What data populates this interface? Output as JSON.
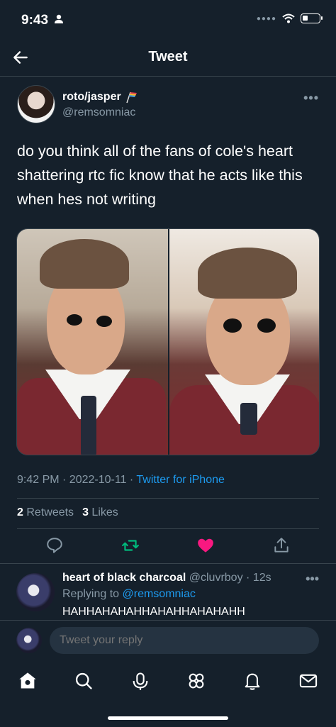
{
  "status_bar": {
    "time": "9:43"
  },
  "nav": {
    "title": "Tweet"
  },
  "tweet": {
    "display_name": "roto/jasper",
    "handle": "@remsomniac",
    "text": "do you think all of the fans of cole's heart shattering rtc fic know that he acts like this when hes not writing",
    "timestamp": "9:42 PM · 2022-10-11 · ",
    "source": "Twitter for iPhone",
    "retweets_count": "2",
    "retweets_label": "Retweets",
    "likes_count": "3",
    "likes_label": "Likes",
    "liked": true,
    "like_color": "#f91880",
    "retweet_color": "#00ba7c",
    "icons": [
      "reply-icon",
      "retweet-icon",
      "heart-icon",
      "share-icon"
    ]
  },
  "reply": {
    "display_name": "heart of black charcoal",
    "handle": "@cluvrboy",
    "time": " · 12s",
    "replying_prefix": "Replying to ",
    "replying_to": "@remsomniac",
    "text": "HAHHAHAHAHHAHAHHAHAHAHH"
  },
  "composer": {
    "placeholder": "Tweet your reply"
  },
  "tabbar": {
    "items": [
      "home-icon",
      "search-icon",
      "spaces-icon",
      "communities-icon",
      "notifications-icon",
      "messages-icon"
    ]
  },
  "colors": {
    "background": "#15202b",
    "accent": "#1d9bf0",
    "secondary_text": "#8899a6"
  }
}
